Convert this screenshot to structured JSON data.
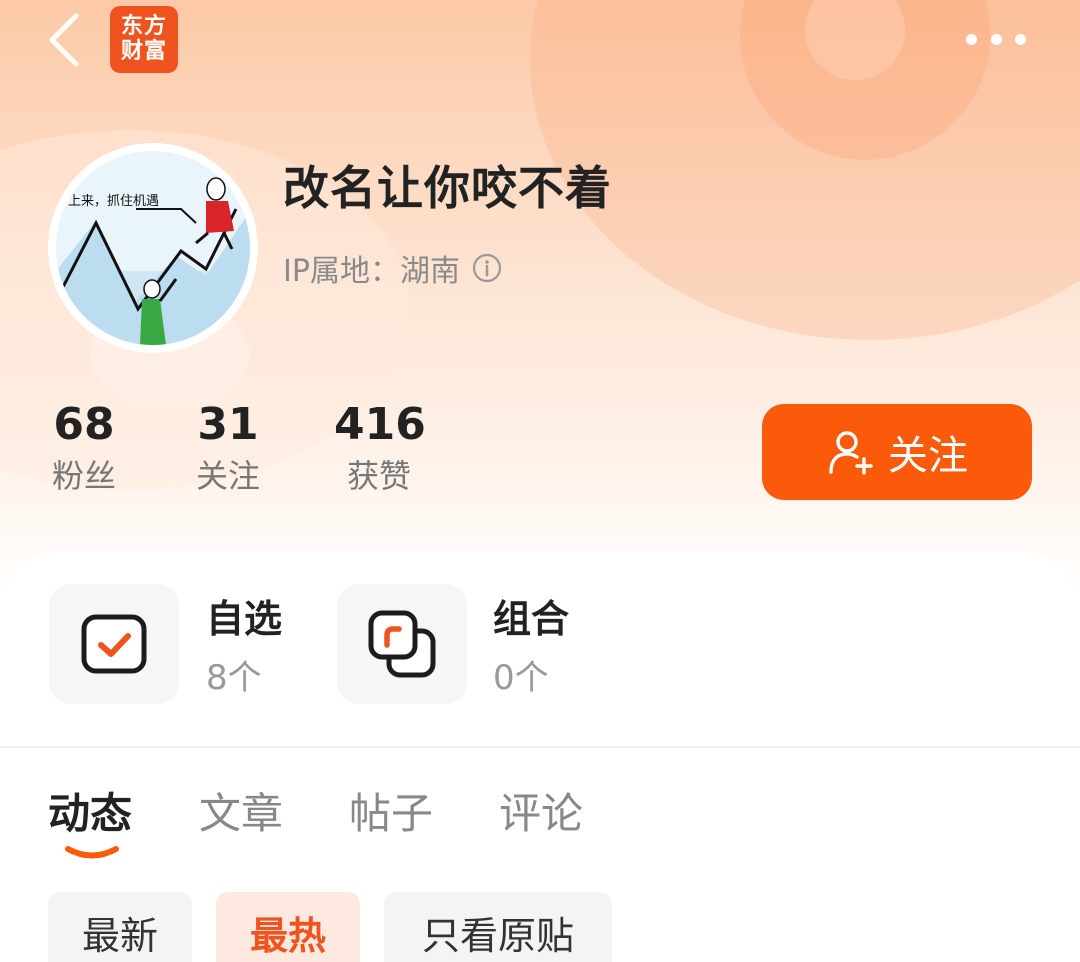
{
  "header": {
    "logo_line1": "东方",
    "logo_line2": "财富",
    "back_icon": "chevron-left-icon",
    "more_icon": "more-dots-icon"
  },
  "profile": {
    "name": "改名让你咬不着",
    "ip_location": "IP属地：湖南",
    "avatar_caption": "上来，抓住机遇"
  },
  "stats": [
    {
      "value": "68",
      "label": "粉丝"
    },
    {
      "value": "31",
      "label": "关注"
    },
    {
      "value": "416",
      "label": "获赞"
    }
  ],
  "follow_button": {
    "label": "关注",
    "icon": "add-user-icon"
  },
  "shortcuts": [
    {
      "title": "自选",
      "count": "8个",
      "icon": "checkbox-icon"
    },
    {
      "title": "组合",
      "count": "0个",
      "icon": "portfolio-icon"
    }
  ],
  "tabs": [
    {
      "label": "动态",
      "active": true
    },
    {
      "label": "文章",
      "active": false
    },
    {
      "label": "帖子",
      "active": false
    },
    {
      "label": "评论",
      "active": false
    }
  ],
  "filters": [
    {
      "label": "最新",
      "active": false
    },
    {
      "label": "最热",
      "active": true
    },
    {
      "label": "只看原贴",
      "active": false
    }
  ],
  "colors": {
    "accent": "#fa5a0a",
    "brand": "#f0541e",
    "text": "#222222",
    "muted": "#888888"
  }
}
